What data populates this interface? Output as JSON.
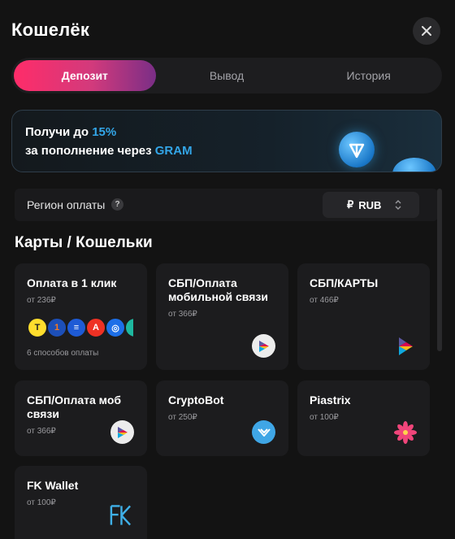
{
  "header": {
    "title": "Кошелёк",
    "close_icon": "close-icon"
  },
  "tabs": [
    {
      "label": "Депозит",
      "active": true
    },
    {
      "label": "Вывод",
      "active": false
    },
    {
      "label": "История",
      "active": false
    }
  ],
  "promo": {
    "line1_prefix": "Получи до ",
    "line1_highlight": "15%",
    "line2_prefix": "за пополнение через ",
    "line2_highlight": "GRAM",
    "highlight_color": "#33a6e8"
  },
  "region": {
    "label": "Регион оплаты",
    "help": "?",
    "currency_symbol": "₽",
    "currency": "RUB"
  },
  "section": {
    "title": "Карты / Кошельки"
  },
  "cards": [
    {
      "title": "Оплата в 1 клик",
      "min": "от 236₽",
      "methods": "6 способов оплаты"
    },
    {
      "title": "СБП/Оплата мобильной связи",
      "min": "от 366₽"
    },
    {
      "title": "СБП/КАРТЫ",
      "min": "от 466₽"
    },
    {
      "title": "СБП/Оплата моб связи",
      "min": "от 366₽"
    },
    {
      "title": "CryptoBot",
      "min": "от 250₽"
    },
    {
      "title": "Piastrix",
      "min": "от 100₽"
    },
    {
      "title": "FK Wallet",
      "min": "от 100₽"
    }
  ],
  "colors": {
    "background": "#131313",
    "card": "#1c1c1e",
    "accent_pink": "#ff2c69",
    "accent_blue": "#33a6e8"
  }
}
